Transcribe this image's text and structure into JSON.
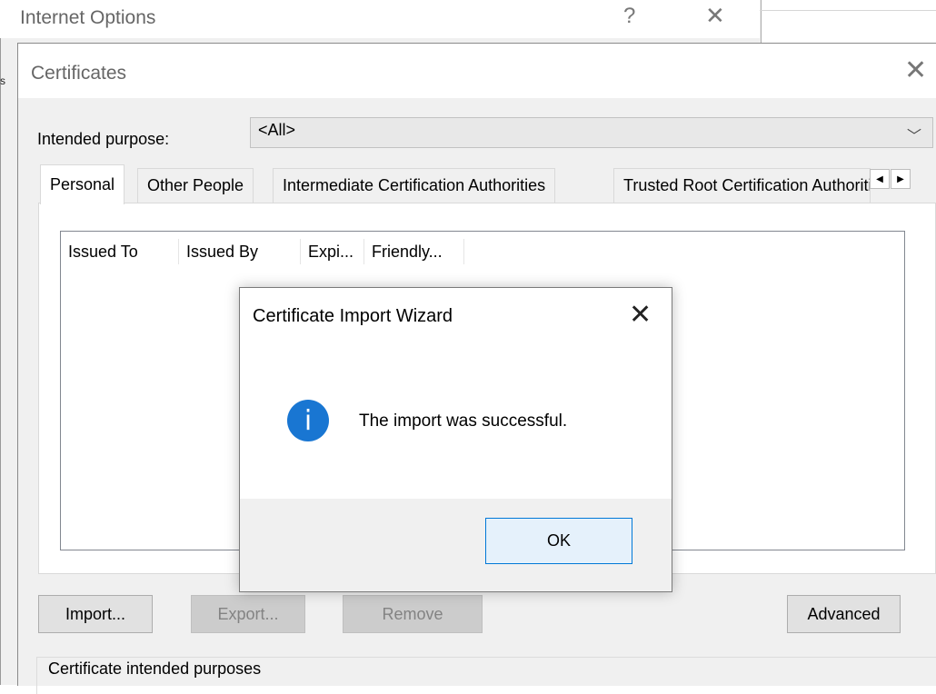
{
  "internet_options": {
    "title": "Internet Options",
    "help_glyph": "?",
    "close_glyph": "✕",
    "edge_fragment": "s"
  },
  "certificates": {
    "title": "Certificates",
    "close_glyph": "✕",
    "intended_purpose_label": "Intended purpose:",
    "intended_purpose_value": "<All>",
    "tabs": [
      {
        "label": "Personal",
        "selected": true
      },
      {
        "label": "Other People"
      },
      {
        "label": "Intermediate Certification Authorities"
      },
      {
        "label": "Trusted Root Certification Authorities"
      }
    ],
    "tab_scroll_left": "◀",
    "tab_scroll_right": "▶",
    "columns": [
      "Issued To",
      "Issued By",
      "Expi...",
      "Friendly..."
    ],
    "buttons": {
      "import": "Import...",
      "export": "Export...",
      "remove": "Remove",
      "advanced": "Advanced"
    },
    "purposes_group_label": "Certificate intended purposes"
  },
  "message_box": {
    "title": "Certificate Import Wizard",
    "close_glyph": "✕",
    "icon": "info-icon",
    "icon_glyph": "i",
    "icon_color": "#1976d2",
    "message": "The import was successful.",
    "ok_label": "OK"
  }
}
